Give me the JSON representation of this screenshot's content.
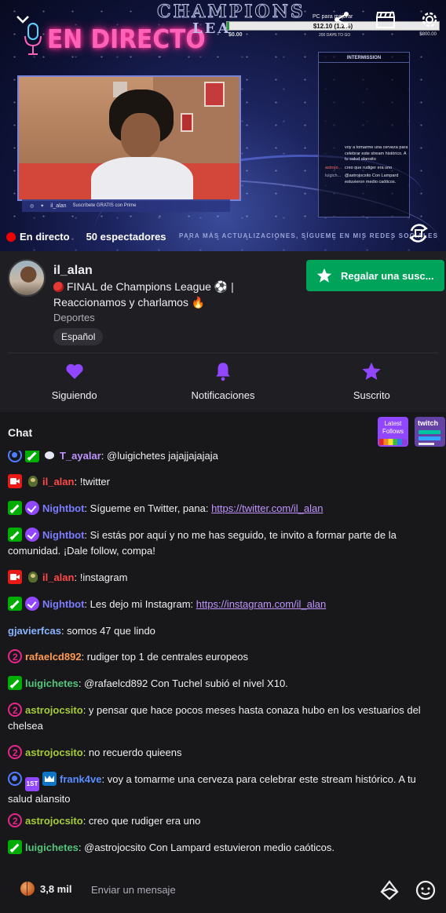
{
  "video": {
    "overlay_title": "EN DIRECTO",
    "overlay_brand_1": "CHAMPIONS",
    "overlay_brand_2": "LEA",
    "goal_label": "PC para mejorar",
    "goal_value": "$12.10 (1.2%)",
    "goal_progress_pct": 1.2,
    "goal_min": "$0.00",
    "goal_days": "200 DAYS TO GO",
    "goal_max": "$800.00",
    "cam_name": "il_alan",
    "cam_promo": "Suscríbete GRATIS con Prime",
    "intermission_title": "INTERMISSION",
    "intermission_chat": [
      {
        "user": "",
        "text": "voy a tomarme una cerveza para celebrar este stream histórico. A tu salud alansito"
      },
      {
        "user": "astrojo...",
        "text": "creo que rudiger era uno"
      },
      {
        "user": "luigich...",
        "text": "@astrojocsito Con Lampard estuvieron medio caóticos."
      }
    ],
    "live_label": "En directo",
    "viewers": "50 espectadores",
    "ticker": "PARA MÁS ACTUALIZACIONES, SÍGUEME EN MIS REDES SOCIALES"
  },
  "channel": {
    "name": "il_alan",
    "title": "FINAL de Champions League ⚽ | Reaccionamos y charlamos 🔥",
    "category": "Deportes",
    "language": "Español",
    "gift_button": "Regalar una susc..."
  },
  "actions": [
    {
      "label": "Siguiendo",
      "icon": "heart-icon"
    },
    {
      "label": "Notificaciones",
      "icon": "bell-icon"
    },
    {
      "label": "Suscrito",
      "icon": "star-icon"
    }
  ],
  "chat": {
    "title": "Chat",
    "ext1_label": "Latest Follows",
    "ext2_label": "twitch",
    "messages": [
      {
        "user": "T_ayalar",
        "color": "#bf94ff",
        "text": "@luigichetes jajajjajajaja",
        "link": ""
      },
      {
        "user": "il_alan",
        "color": "#ff4848",
        "text": "!twitter",
        "link": ""
      },
      {
        "user": "Nightbot",
        "color": "#7c7cff",
        "text": "Sígueme en Twitter, pana: ",
        "link": "https://twitter.com/il_alan"
      },
      {
        "user": "Nightbot",
        "color": "#7c7cff",
        "text": "Si estás por aquí y no me has seguido, te invito a formar parte de la comunidad. ¡Dale follow, compa!",
        "link": ""
      },
      {
        "user": "il_alan",
        "color": "#ff4848",
        "text": "!instagram",
        "link": ""
      },
      {
        "user": "Nightbot",
        "color": "#7c7cff",
        "text": "Les dejo mi Instagram: ",
        "link": "https://instagram.com/il_alan"
      },
      {
        "user": "gjavierfcas",
        "color": "#8ab4ff",
        "text": "somos 47 que lindo",
        "link": ""
      },
      {
        "user": "rafaelcd892",
        "color": "#ff9b52",
        "text": "rudiger top 1 de centrales europeos",
        "link": ""
      },
      {
        "user": "luigichetes",
        "color": "#55c47b",
        "text": "@rafaelcd892 Con Tuchel subió el nivel X10.",
        "link": ""
      },
      {
        "user": "astrojocsito",
        "color": "#a6cc3b",
        "text": "y pensar que hace pocos meses hasta conaza hubo en los vestuarios del chelsea",
        "link": ""
      },
      {
        "user": "astrojocsito",
        "color": "#a6cc3b",
        "text": "no recuerdo quieens",
        "link": ""
      },
      {
        "user": "frank4ve",
        "color": "#5a8dff",
        "text": "voy a tomarme una cerveza para celebrar este stream histórico. A tu salud alansito",
        "link": ""
      },
      {
        "user": "astrojocsito",
        "color": "#a6cc3b",
        "text": "creo que rudiger era uno",
        "link": ""
      },
      {
        "user": "luigichetes",
        "color": "#55c47b",
        "text": "@astrojocsito Con Lampard estuvieron medio caóticos.",
        "link": ""
      }
    ]
  },
  "bottom": {
    "points": "3,8 mil",
    "placeholder": "Enviar un mensaje"
  },
  "colors": {
    "accent": "#9147ff",
    "gift": "#00a35a",
    "live": "#eb0400"
  }
}
